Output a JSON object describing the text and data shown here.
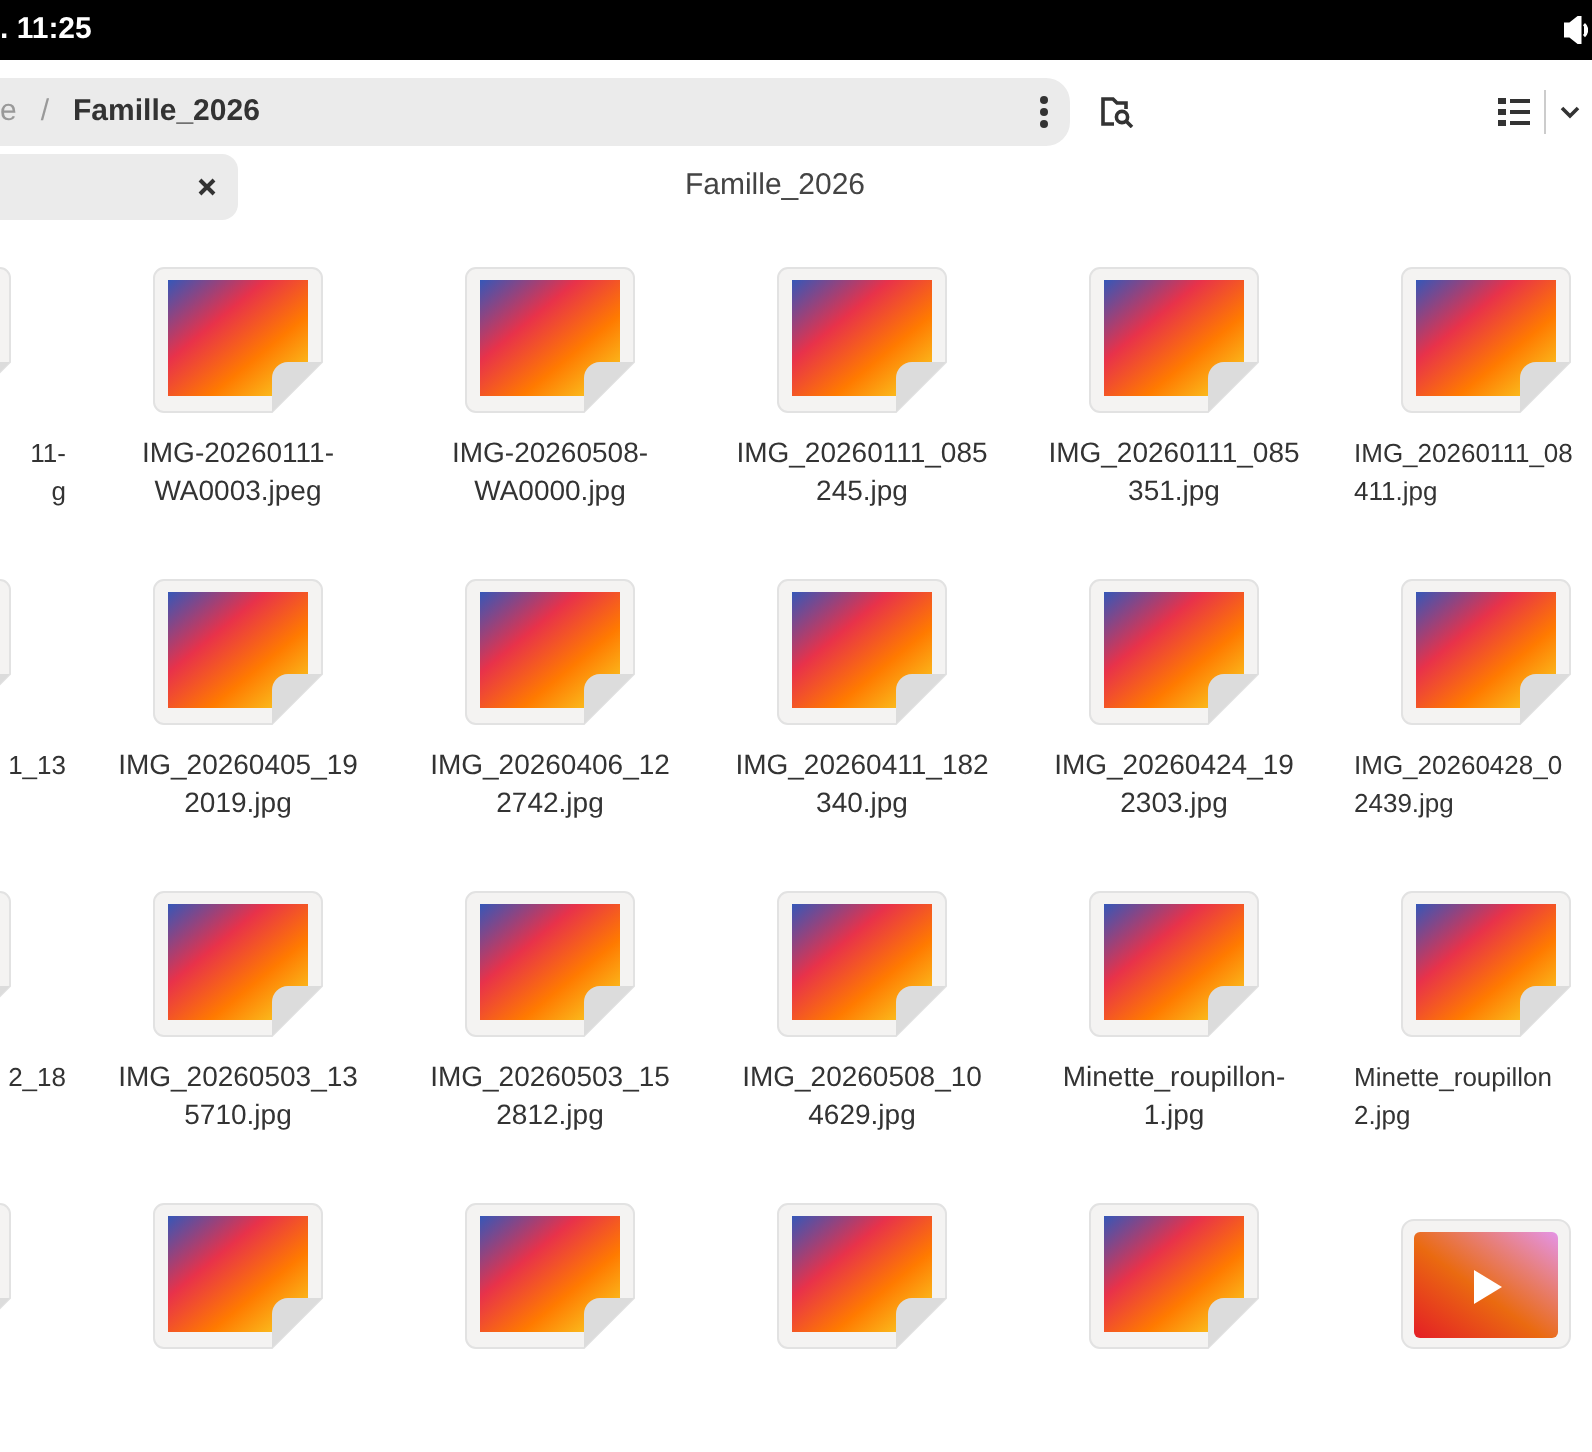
{
  "status_bar": {
    "time": ". 11:25"
  },
  "path_bar": {
    "segments": [
      {
        "label": "e",
        "current": false
      },
      {
        "label": "Famille_2026",
        "current": true
      }
    ],
    "separator": "/"
  },
  "window": {
    "title": "Famille_2026"
  },
  "files": [
    {
      "kind": "image",
      "lines": [
        "11-",
        "g"
      ]
    },
    {
      "kind": "image",
      "lines": [
        "IMG-20260111-",
        "WA0003.jpeg"
      ]
    },
    {
      "kind": "image",
      "lines": [
        "IMG-20260508-",
        "WA0000.jpg"
      ]
    },
    {
      "kind": "image",
      "lines": [
        "IMG_20260111_085",
        "245.jpg"
      ]
    },
    {
      "kind": "image",
      "lines": [
        "IMG_20260111_085",
        "351.jpg"
      ]
    },
    {
      "kind": "image",
      "lines": [
        "IMG_20260111_08",
        "411.jpg"
      ]
    },
    {
      "kind": "image",
      "lines": [
        "1_13"
      ]
    },
    {
      "kind": "image",
      "lines": [
        "IMG_20260405_19",
        "2019.jpg"
      ]
    },
    {
      "kind": "image",
      "lines": [
        "IMG_20260406_12",
        "2742.jpg"
      ]
    },
    {
      "kind": "image",
      "lines": [
        "IMG_20260411_182",
        "340.jpg"
      ]
    },
    {
      "kind": "image",
      "lines": [
        "IMG_20260424_19",
        "2303.jpg"
      ]
    },
    {
      "kind": "image",
      "lines": [
        "IMG_20260428_0",
        "2439.jpg"
      ]
    },
    {
      "kind": "image",
      "lines": [
        "2_18"
      ]
    },
    {
      "kind": "image",
      "lines": [
        "IMG_20260503_13",
        "5710.jpg"
      ]
    },
    {
      "kind": "image",
      "lines": [
        "IMG_20260503_15",
        "2812.jpg"
      ]
    },
    {
      "kind": "image",
      "lines": [
        "IMG_20260508_10",
        "4629.jpg"
      ]
    },
    {
      "kind": "image",
      "lines": [
        "Minette_roupillon-",
        "1.jpg"
      ]
    },
    {
      "kind": "image",
      "lines": [
        "Minette_roupillon",
        "2.jpg"
      ]
    },
    {
      "kind": "image"
    },
    {
      "kind": "image"
    },
    {
      "kind": "image"
    },
    {
      "kind": "image"
    },
    {
      "kind": "image"
    },
    {
      "kind": "video"
    }
  ]
}
